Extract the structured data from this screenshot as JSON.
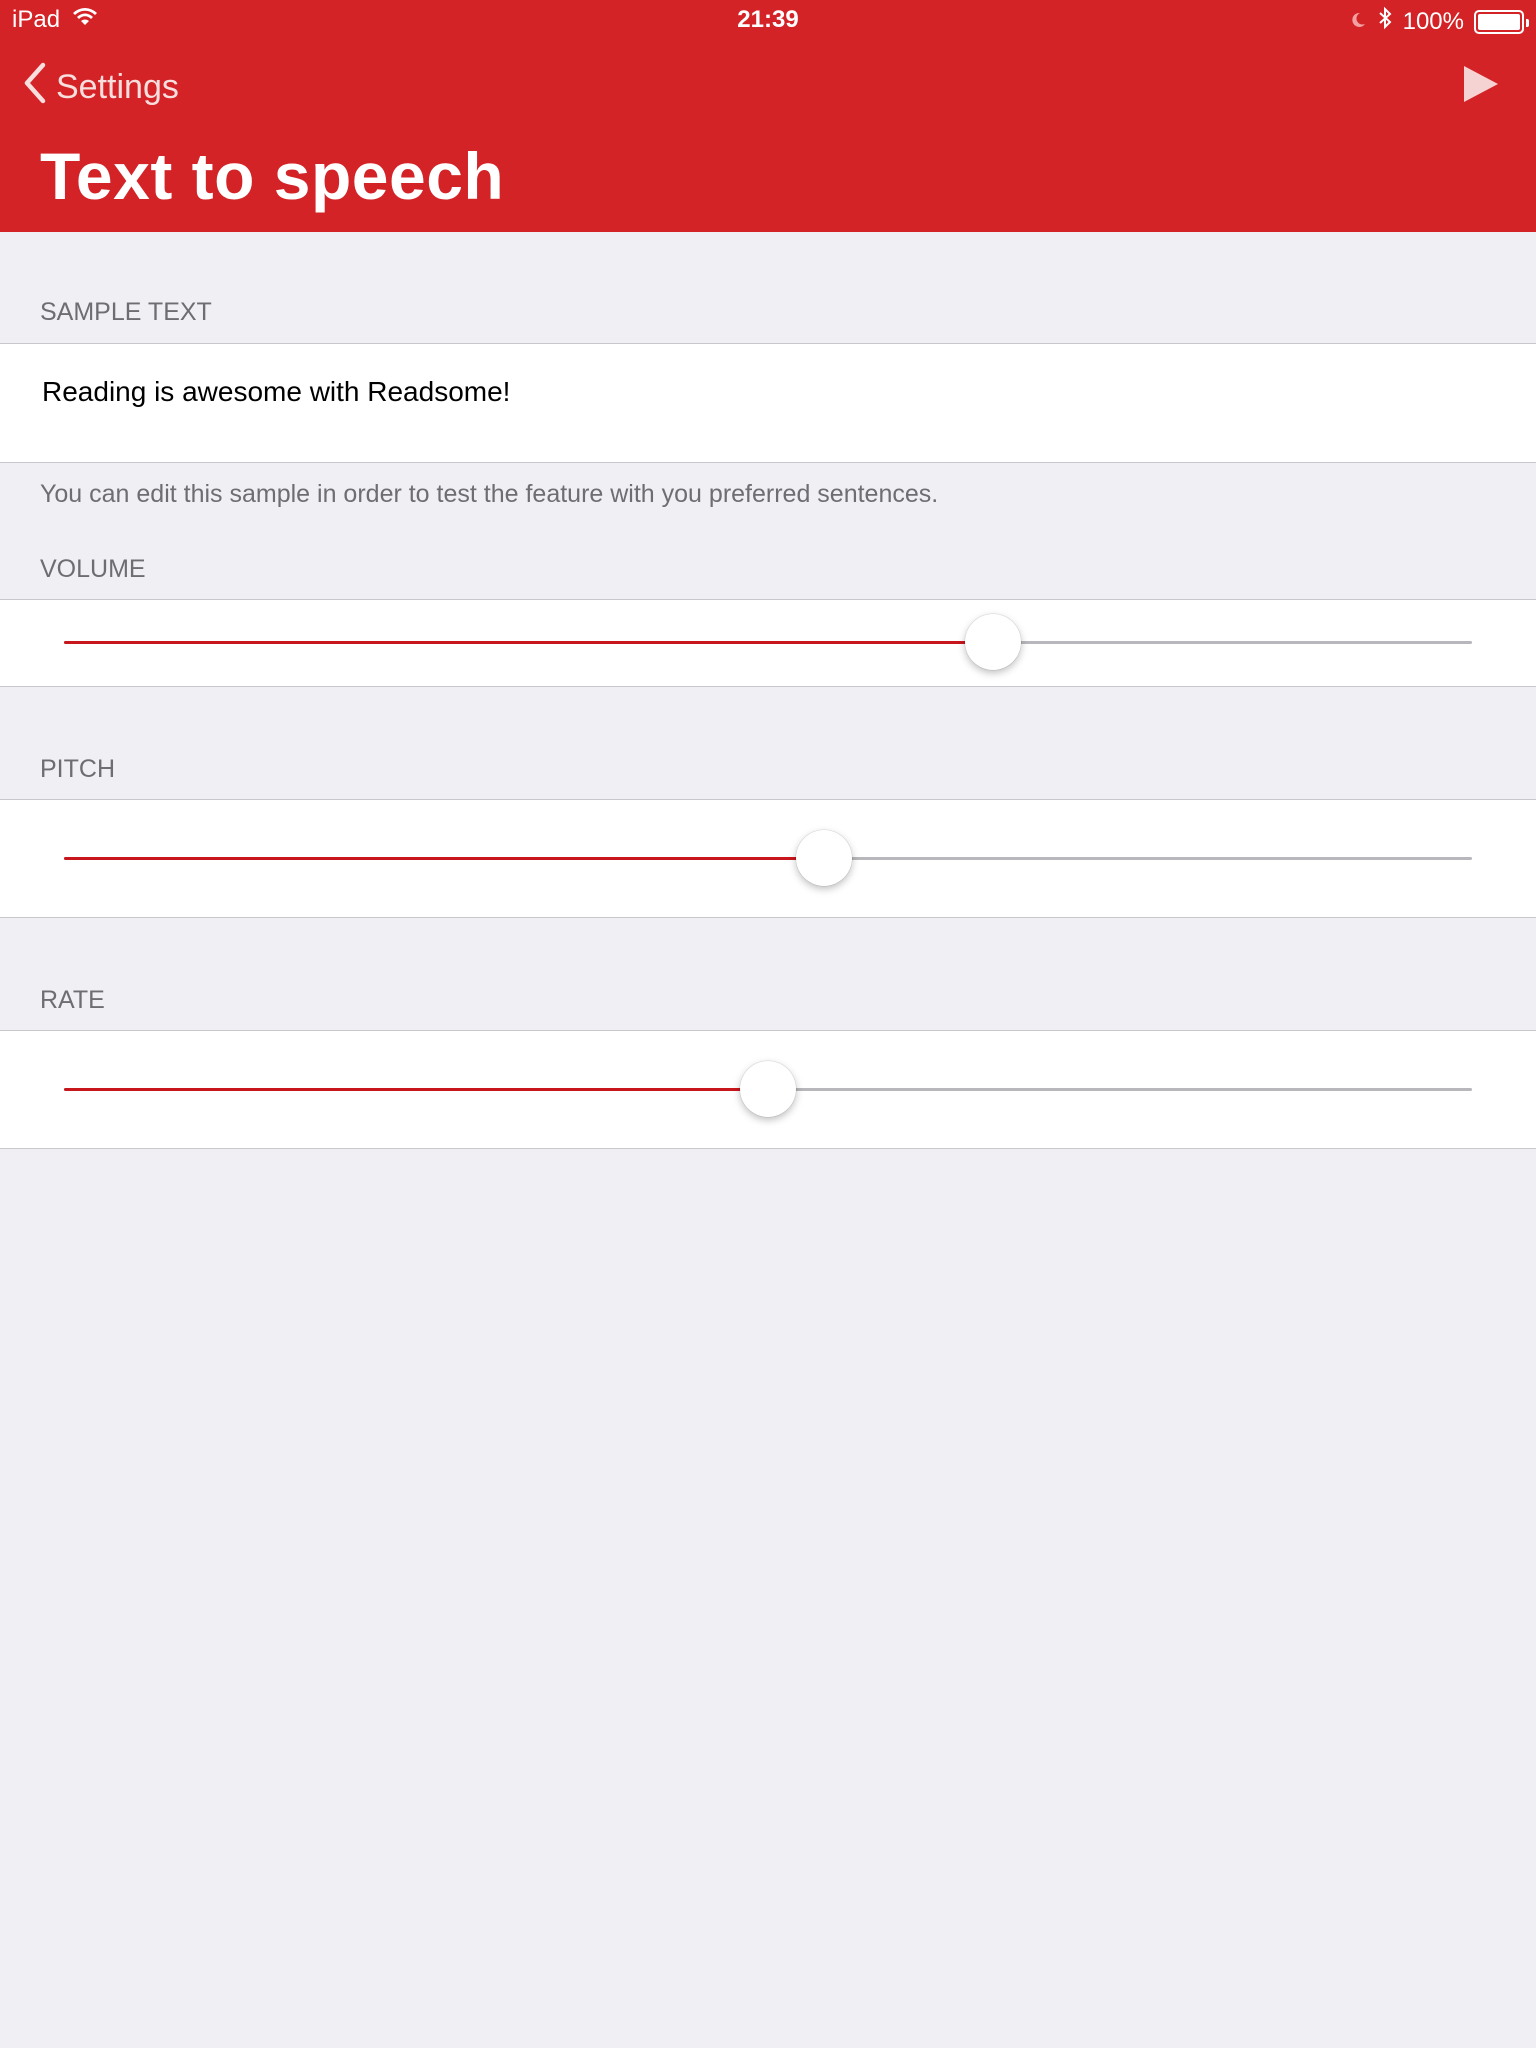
{
  "status_bar": {
    "device": "iPad",
    "time": "21:39",
    "battery": "100%"
  },
  "nav": {
    "back_label": "Settings",
    "title": "Text to speech"
  },
  "colors": {
    "accent": "#d32327",
    "slider_fill": "#c8161d"
  },
  "sample_text": {
    "header": "SAMPLE TEXT",
    "value": "Reading is awesome with Readsome!",
    "footer": "You can edit this sample in order to test the feature with you preferred sentences."
  },
  "volume": {
    "header": "VOLUME",
    "value": 0.66
  },
  "pitch": {
    "header": "PITCH",
    "value": 0.54
  },
  "rate": {
    "header": "RATE",
    "value": 0.5
  }
}
